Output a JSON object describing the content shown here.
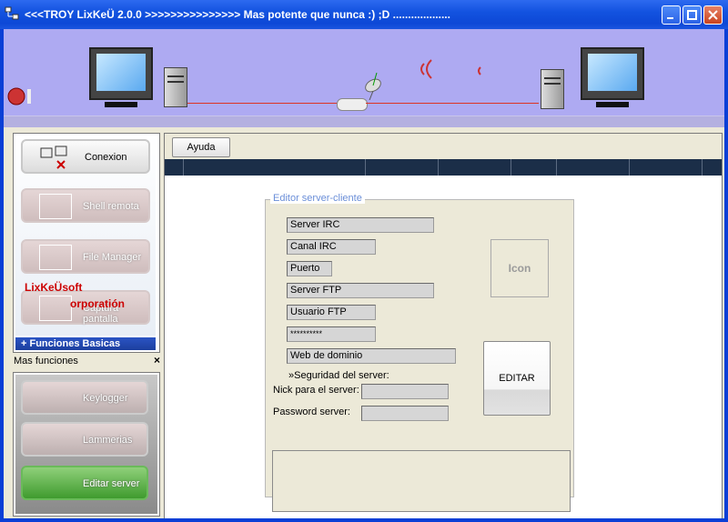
{
  "window": {
    "title": "<<<TROY LixKeÜ 2.0.0 >>>>>>>>>>>>>>> Mas potente que nunca :)  ;D ...................",
    "min_icon": "minimize-icon",
    "max_icon": "maximize-icon",
    "close_icon": "close-icon"
  },
  "toolbar": {
    "ayuda_label": "Ayuda"
  },
  "sidebar": {
    "items": [
      {
        "label": "Conexion",
        "icon": "network-icon",
        "active": true
      },
      {
        "label": "Shell remota",
        "icon": "shell-icon",
        "active": false
      },
      {
        "label": "File Manager",
        "icon": "folder-icon",
        "active": false
      },
      {
        "label": "Captura pantalla",
        "icon": "screen-icon",
        "active": false
      }
    ],
    "brand_line1": "LixKeÜsoft",
    "brand_line2": "orporatión",
    "section_title": "+ Funciones Basicas"
  },
  "mas_funciones": {
    "title": "Mas funciones",
    "close": "×",
    "items": [
      {
        "label": "Keylogger",
        "icon": "keyboard-icon"
      },
      {
        "label": "Lammerias",
        "icon": "hand-icon"
      },
      {
        "label": "Editar server",
        "icon": "hammer-icon"
      }
    ]
  },
  "editor": {
    "legend": "Editor server-cliente",
    "server_irc": "Server IRC",
    "canal_irc": "Canal IRC",
    "puerto": "Puerto",
    "server_ftp": "Server FTP",
    "usuario_ftp": "Usuario FTP",
    "password_ftp": "**********",
    "web_dominio": "Web de dominio",
    "seguridad_label": "»Seguridad del server:",
    "nick_label": "Nick para el server:",
    "nick_value": "",
    "password_label": "Password server:",
    "password_value": "",
    "icon_label": "Icon",
    "editar_label": "EDITAR"
  }
}
